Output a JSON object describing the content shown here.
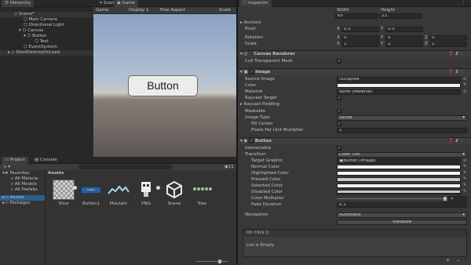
{
  "hierarchy": {
    "tab": "Hierarchy",
    "items": [
      "Scene*",
      "Main Camera",
      "Directional Light",
      "Canvas",
      "Button",
      "Text",
      "EventSystem",
      "DontDestroyOnLoad"
    ]
  },
  "game_view": {
    "tabs": [
      "Scene",
      "Game"
    ],
    "display_select": "Game",
    "display": "Display 1",
    "aspect": "Free Aspect",
    "scale_label": "Scale",
    "button_text": "Button"
  },
  "project": {
    "tabs": [
      "Project",
      "Console"
    ],
    "favorites_label": "Favorites",
    "favorites": [
      "All Materia",
      "All Models",
      "All Prefabs"
    ],
    "assets_label": "Assets",
    "packages_label": "Packages",
    "breadcrumb": "Assets",
    "count": "11",
    "assets": [
      {
        "name": "Slice",
        "icon": "slice-thumbnail"
      },
      {
        "name": "Button1",
        "icon": "button-sprite-thumbnail"
      },
      {
        "name": "Moutain",
        "icon": "mountain-thumbnail"
      },
      {
        "name": "PNG",
        "icon": "png-thumbnail"
      },
      {
        "name": "Scene",
        "icon": "unity-scene-icon"
      },
      {
        "name": "Tree",
        "icon": "tree-thumbnail"
      }
    ]
  },
  "inspector": {
    "tab": "Inspector",
    "width_label": "Width",
    "height_label": "Height",
    "width": "65",
    "height": "23",
    "anchors": "Anchors",
    "pivot_label": "Pivot",
    "pivot_x": "0.5",
    "pivot_y": "0.5",
    "rotation_label": "Rotation",
    "rot_x": "0",
    "rot_y": "0",
    "rot_z": "0",
    "scale_label": "Scale",
    "scale_x": "1",
    "scale_y": "1",
    "scale_z": "1",
    "axis_x": "X",
    "axis_y": "Y",
    "axis_z": "Z",
    "canvas_renderer": "Canvas Renderer",
    "cull_transparent": "Cull Transparent Mesh",
    "image": {
      "header": "Image",
      "source_image_label": "Source Image",
      "source_image": "UISprite",
      "color_label": "Color",
      "material_label": "Material",
      "material": "None (Material)",
      "raycast_target": "Raycast Target",
      "raycast_padding": "Raycast Padding",
      "maskable": "Maskable",
      "image_type_label": "Image Type",
      "image_type": "Sliced",
      "fill_center": "Fill Center",
      "ppu_label": "Pixels Per Unit Multiplier",
      "ppu": "1"
    },
    "button": {
      "header": "Button",
      "interactable": "Interactable",
      "transition_label": "Transition",
      "transition": "Color Tint",
      "target_graphic_label": "Target Graphic",
      "target_graphic": "Button (Image)",
      "normal_color": "Normal Color",
      "highlighted_color": "Highlighted Color",
      "pressed_color": "Pressed Color",
      "selected_color": "Selected Color",
      "disabled_color": "Disabled Color",
      "color_multiplier_label": "Color Multiplier",
      "color_multiplier": "1",
      "fade_duration_label": "Fade Duration",
      "fade_duration": "0.1",
      "navigation_label": "Navigation",
      "navigation": "Automatic",
      "visualize": "Visualize",
      "onclick": "On Click ()",
      "list_empty": "List is Empty"
    }
  },
  "colors": {
    "accent": "#2c5d87",
    "selection": "#2c5d87"
  }
}
